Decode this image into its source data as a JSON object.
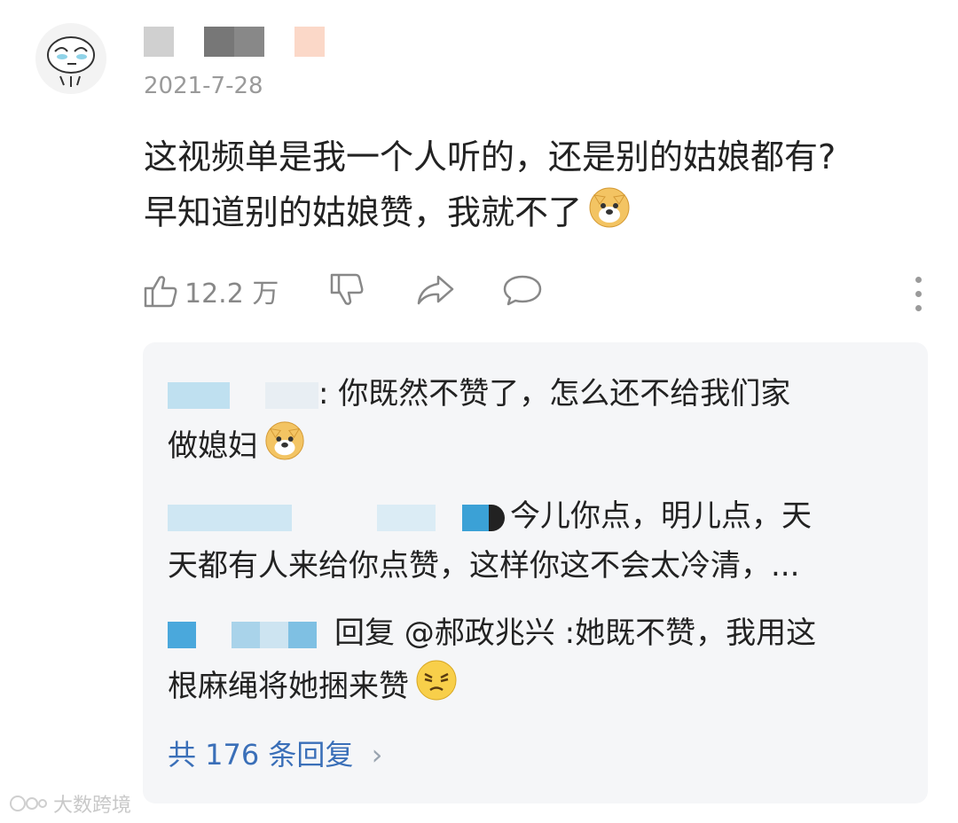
{
  "comment": {
    "date": "2021-7-28",
    "text_line1": "这视频单是我一个人听的，还是别的姑娘都有?",
    "text_line2": "早知道别的姑娘赞，我就不了",
    "likes": "12.2 万"
  },
  "replies": [
    {
      "text": ": 你既然不赞了，怎么还不给我们家",
      "text2": "做媳妇"
    },
    {
      "text": "今儿你点，明儿点，天",
      "text2": "天都有人来给你点赞，这样你这不会太冷清，..."
    },
    {
      "text": "回复 @郝政兆兴 :她既不赞，我用这",
      "text2": "根麻绳将她捆来赞"
    }
  ],
  "more_replies": "共 176 条回复",
  "watermark": "大数跨境",
  "icons": [
    "avatar-sticker",
    "like-icon",
    "dislike-icon",
    "share-icon",
    "comment-icon",
    "more-icon",
    "doge-emoji",
    "annoyed-emoji",
    "chevron-right-icon"
  ]
}
